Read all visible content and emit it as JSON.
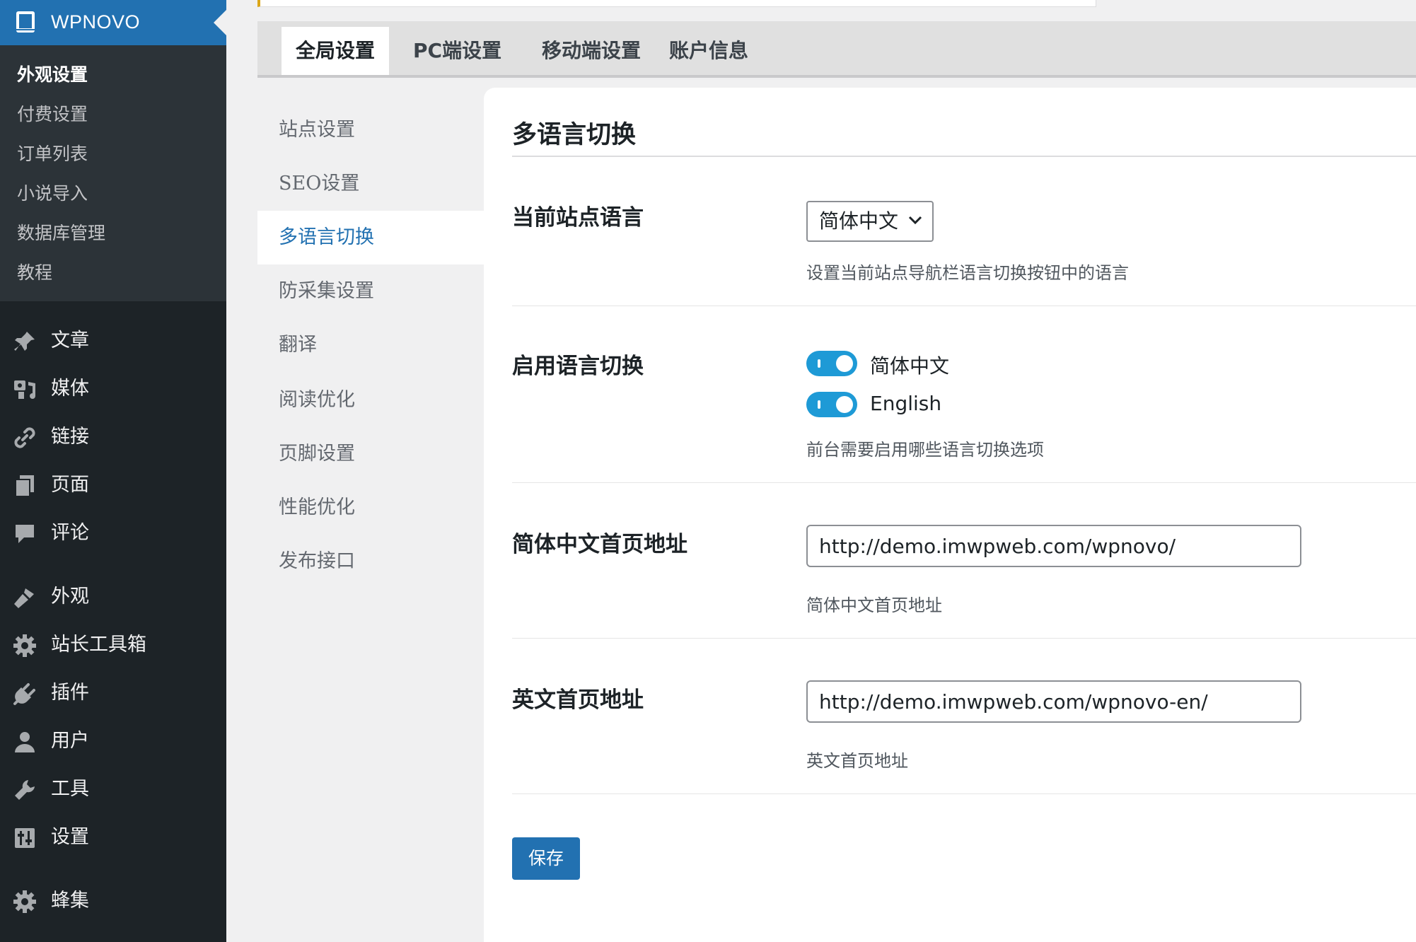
{
  "brand": {
    "title": "WPNOVO"
  },
  "colors": {
    "accent": "#2271b1",
    "sidebar": "#1d2327",
    "toggle_on": "#1e9ad6"
  },
  "submenu": {
    "items": [
      {
        "label": "外观设置",
        "current": true
      },
      {
        "label": "付费设置"
      },
      {
        "label": "订单列表"
      },
      {
        "label": "小说导入"
      },
      {
        "label": "数据库管理"
      },
      {
        "label": "教程"
      }
    ]
  },
  "menu": {
    "items": [
      {
        "label": "文章",
        "icon": "pin-icon"
      },
      {
        "label": "媒体",
        "icon": "media-icon"
      },
      {
        "label": "链接",
        "icon": "link-icon"
      },
      {
        "label": "页面",
        "icon": "pages-icon"
      },
      {
        "label": "评论",
        "icon": "comment-icon"
      },
      {
        "label": "外观",
        "icon": "brush-icon"
      },
      {
        "label": "站长工具箱",
        "icon": "gear-icon"
      },
      {
        "label": "插件",
        "icon": "plugin-icon"
      },
      {
        "label": "用户",
        "icon": "user-icon"
      },
      {
        "label": "工具",
        "icon": "wrench-icon"
      },
      {
        "label": "设置",
        "icon": "sliders-icon"
      },
      {
        "label": "蜂集",
        "icon": "gear-icon"
      }
    ]
  },
  "tabs": [
    {
      "label": "全局设置",
      "active": true
    },
    {
      "label": "PC端设置"
    },
    {
      "label": "移动端设置"
    },
    {
      "label": "账户信息"
    }
  ],
  "subnav": {
    "items": [
      {
        "label": "站点设置"
      },
      {
        "label": "SEO设置"
      },
      {
        "label": "多语言切换",
        "active": true
      },
      {
        "label": "防采集设置"
      },
      {
        "label": "翻译"
      },
      {
        "label": "阅读优化"
      },
      {
        "label": "页脚设置"
      },
      {
        "label": "性能优化"
      },
      {
        "label": "发布接口"
      }
    ]
  },
  "panel": {
    "title": "多语言切换",
    "current_language": {
      "label": "当前站点语言",
      "selected": "简体中文",
      "description": "设置当前站点导航栏语言切换按钮中的语言"
    },
    "enable_switch": {
      "label": "启用语言切换",
      "options": [
        {
          "label": "简体中文",
          "enabled": true
        },
        {
          "label": "English",
          "enabled": true
        }
      ],
      "description": "前台需要启用哪些语言切换选项"
    },
    "zh_home": {
      "label": "简体中文首页地址",
      "value": "http://demo.imwpweb.com/wpnovo/",
      "description": "简体中文首页地址"
    },
    "en_home": {
      "label": "英文首页地址",
      "value": "http://demo.imwpweb.com/wpnovo-en/",
      "description": "英文首页地址"
    },
    "save_label": "保存"
  }
}
